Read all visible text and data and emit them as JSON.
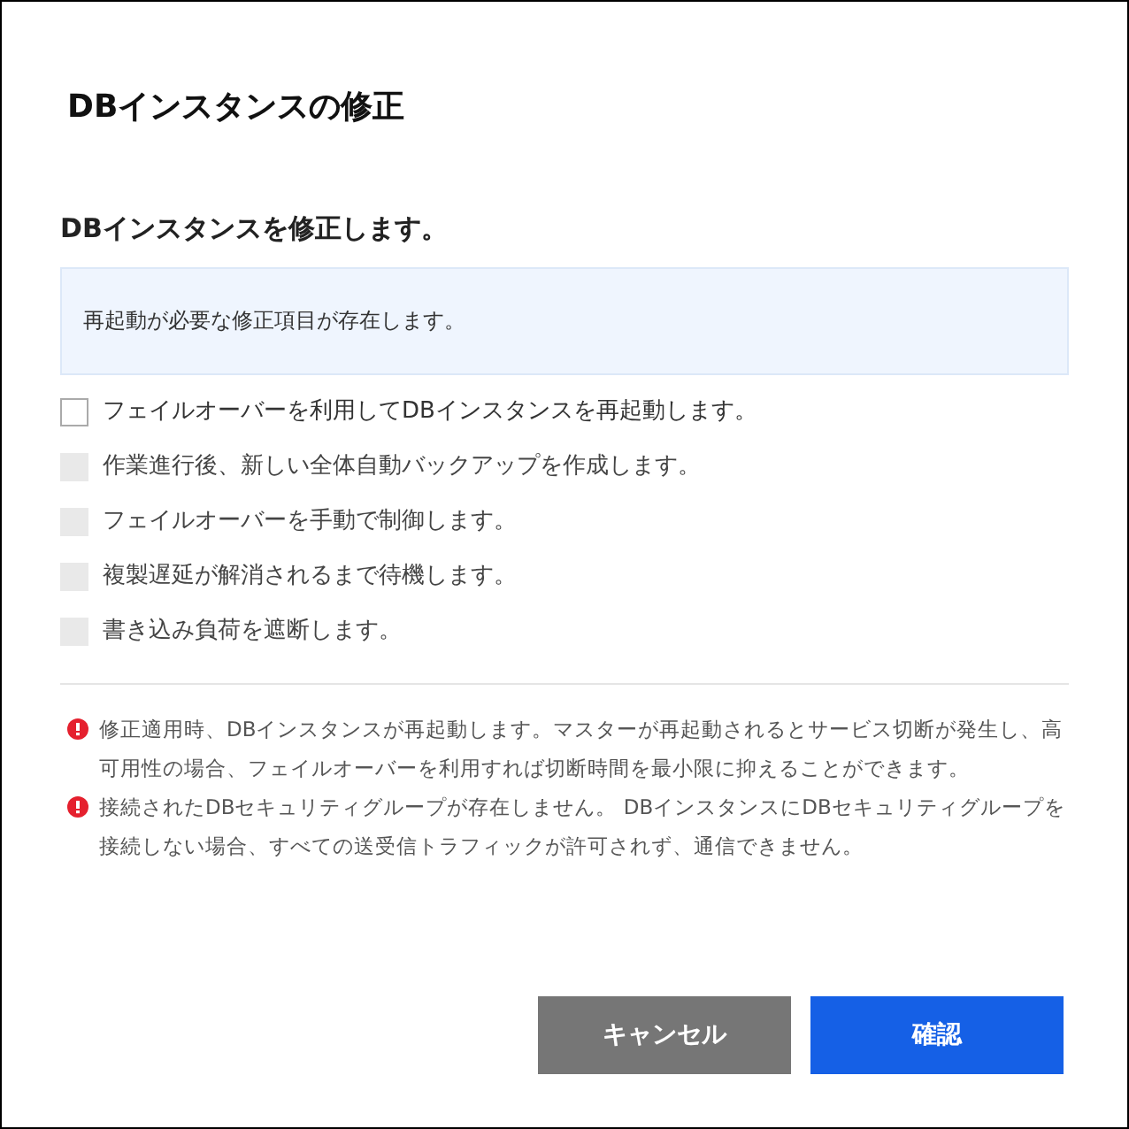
{
  "dialog": {
    "title": "DBインスタンスの修正",
    "subtitle": "DBインスタンスを修正します。",
    "info": "再起動が必要な修正項目が存在します。",
    "options": [
      {
        "label": "フェイルオーバーを利用してDBインスタンスを再起動します。",
        "checked": false,
        "disabled": false
      },
      {
        "label": "作業進行後、新しい全体自動バックアップを作成します。",
        "checked": false,
        "disabled": true
      },
      {
        "label": "フェイルオーバーを手動で制御します。",
        "checked": false,
        "disabled": true
      },
      {
        "label": "複製遅延が解消されるまで待機します。",
        "checked": false,
        "disabled": true
      },
      {
        "label": "書き込み負荷を遮断します。",
        "checked": false,
        "disabled": true
      }
    ],
    "warnings": [
      "修正適用時、DBインスタンスが再起動します。マスターが再起動されるとサービス切断が発生し、高可用性の場合、フェイルオーバーを利用すれば切断時間を最小限に抑えることができます。",
      "接続されたDBセキュリティグループが存在しません。 DBインスタンスにDBセキュリティグループを接続しない場合、すべての送受信トラフィックが許可されず、通信できません。"
    ],
    "buttons": [
      {
        "label": "キャンセル",
        "kind": "secondary"
      },
      {
        "label": "確認",
        "kind": "primary"
      }
    ]
  }
}
